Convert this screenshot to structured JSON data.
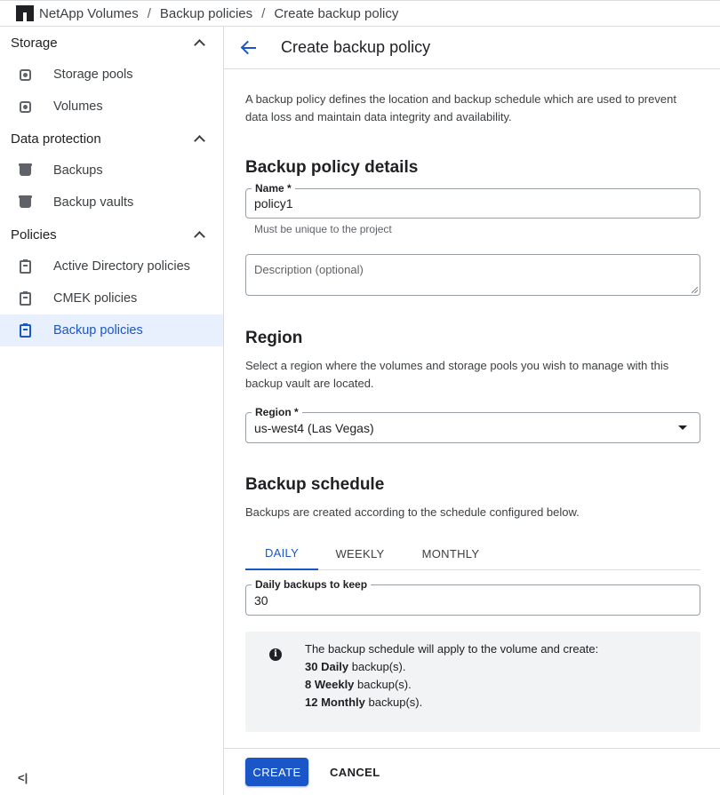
{
  "breadcrumb": {
    "items": [
      "NetApp Volumes",
      "Backup policies",
      "Create backup policy"
    ],
    "separator": "/"
  },
  "sidebar": {
    "sections": [
      {
        "title": "Storage",
        "items": [
          {
            "label": "Storage pools",
            "icon": "disk-icon"
          },
          {
            "label": "Volumes",
            "icon": "disk-icon"
          }
        ]
      },
      {
        "title": "Data protection",
        "items": [
          {
            "label": "Backups",
            "icon": "bucket-icon"
          },
          {
            "label": "Backup vaults",
            "icon": "bucket-icon"
          }
        ]
      },
      {
        "title": "Policies",
        "items": [
          {
            "label": "Active Directory policies",
            "icon": "clipboard-icon"
          },
          {
            "label": "CMEK policies",
            "icon": "clipboard-icon"
          },
          {
            "label": "Backup policies",
            "icon": "clipboard-icon",
            "active": true
          }
        ]
      }
    ],
    "collapse_glyph": "<|"
  },
  "main": {
    "title": "Create backup policy",
    "intro": "A backup policy defines the location and backup schedule which are used to prevent data loss and maintain data integrity and availability.",
    "details": {
      "heading": "Backup policy details",
      "name_label": "Name *",
      "name_value": "policy1",
      "name_hint": "Must be unique to the project",
      "description_placeholder": "Description (optional)"
    },
    "region": {
      "heading": "Region",
      "description": "Select a region where the volumes and storage pools you wish to manage with this backup vault are located.",
      "label": "Region *",
      "value": "us-west4 (Las Vegas)"
    },
    "schedule": {
      "heading": "Backup schedule",
      "description": "Backups are created according to the schedule configured below.",
      "tabs": [
        "DAILY",
        "WEEKLY",
        "MONTHLY"
      ],
      "active_tab": "DAILY",
      "keep_label": "Daily backups to keep",
      "keep_value": "30",
      "info": {
        "intro": "The backup schedule will apply to the volume and create:",
        "daily_count": "30 Daily",
        "weekly_count": "8 Weekly",
        "monthly_count": "12 Monthly",
        "suffix": " backup(s)."
      }
    },
    "actions": {
      "create": "CREATE",
      "cancel": "CANCEL"
    }
  },
  "colors": {
    "accent": "#1a56c8",
    "active_bg": "#e8f0fe",
    "info_bg": "#f1f3f4",
    "border": "#dadce0"
  }
}
